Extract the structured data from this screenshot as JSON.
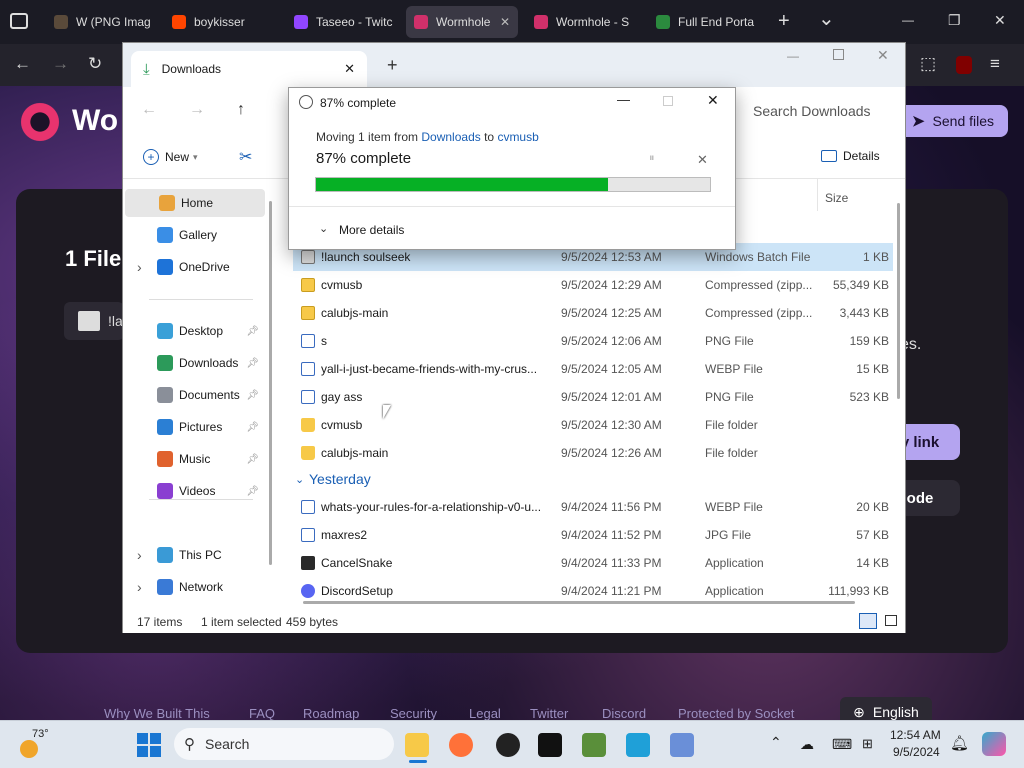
{
  "browser": {
    "tabs": [
      {
        "label": "W (PNG Imag",
        "color": "#5a4a3a"
      },
      {
        "label": "boykisser",
        "color": "#ff4500"
      },
      {
        "label": "Taseeo - Twitc",
        "color": "#9146ff"
      },
      {
        "label": "Wormhole",
        "color": "#d0306a"
      },
      {
        "label": "Wormhole - S",
        "color": "#d0306a"
      },
      {
        "label": "Full End Porta",
        "color": "#2b8a3e"
      }
    ],
    "new_tab": "+",
    "tab_list": "⌄",
    "min": "—",
    "max": "❐",
    "close": "✕"
  },
  "site": {
    "logo_text": "Wo",
    "send_files": "Send files",
    "heading": "1 File",
    "file_chip": "!la",
    "side_text": "es.",
    "copy_link": "y link",
    "code_btn": "ode",
    "footer": [
      "Why We Built This",
      "FAQ",
      "Roadmap",
      "Security",
      "Legal",
      "Twitter",
      "Discord",
      "Protected by Socket"
    ],
    "language": "English"
  },
  "explorer": {
    "tab_title": "Downloads",
    "new_tab": "+",
    "search_placeholder": "Search Downloads",
    "new_label": "New",
    "details_label": "Details",
    "size_header": "Size",
    "sidebar": [
      {
        "label": "Home",
        "color": "#e8a33c",
        "selected": true
      },
      {
        "label": "Gallery",
        "color": "#3a8ee6"
      },
      {
        "label": "OneDrive",
        "color": "#1e73d8",
        "expand": true
      },
      {
        "label": "Desktop",
        "color": "#3aa0d8",
        "pin": true
      },
      {
        "label": "Downloads",
        "color": "#2c9a5a",
        "pin": true
      },
      {
        "label": "Documents",
        "color": "#8a8f99",
        "pin": true
      },
      {
        "label": "Pictures",
        "color": "#2b7fd4",
        "pin": true
      },
      {
        "label": "Music",
        "color": "#e0622e",
        "pin": true
      },
      {
        "label": "Videos",
        "color": "#8a3fd1",
        "pin": true
      },
      {
        "label": "This PC",
        "color": "#3a9ad6",
        "expand": true
      },
      {
        "label": "Network",
        "color": "#3a7ad6",
        "expand": true
      }
    ],
    "files_today": [
      {
        "name": "!launch soulseek",
        "date": "9/5/2024 12:53 AM",
        "type": "Windows Batch File",
        "size": "1 KB",
        "icon": "bat",
        "selected": true
      },
      {
        "name": "cvmusb",
        "date": "9/5/2024 12:29 AM",
        "type": "Compressed (zipp...",
        "size": "55,349 KB",
        "icon": "zip"
      },
      {
        "name": "calubjs-main",
        "date": "9/5/2024 12:25 AM",
        "type": "Compressed (zipp...",
        "size": "3,443 KB",
        "icon": "zip"
      },
      {
        "name": "s",
        "date": "9/5/2024 12:06 AM",
        "type": "PNG File",
        "size": "159 KB",
        "icon": "doc"
      },
      {
        "name": "yall-i-just-became-friends-with-my-crus...",
        "date": "9/5/2024 12:05 AM",
        "type": "WEBP File",
        "size": "15 KB",
        "icon": "doc"
      },
      {
        "name": "gay ass",
        "date": "9/5/2024 12:01 AM",
        "type": "PNG File",
        "size": "523 KB",
        "icon": "doc"
      },
      {
        "name": "cvmusb",
        "date": "9/5/2024 12:30 AM",
        "type": "File folder",
        "size": "",
        "icon": "folder"
      },
      {
        "name": "calubjs-main",
        "date": "9/5/2024 12:26 AM",
        "type": "File folder",
        "size": "",
        "icon": "folder"
      }
    ],
    "group_yesterday": "Yesterday",
    "files_yesterday": [
      {
        "name": "whats-your-rules-for-a-relationship-v0-u...",
        "date": "9/4/2024 11:56 PM",
        "type": "WEBP File",
        "size": "20 KB",
        "icon": "doc"
      },
      {
        "name": "maxres2",
        "date": "9/4/2024 11:52 PM",
        "type": "JPG File",
        "size": "57 KB",
        "icon": "doc"
      },
      {
        "name": "CancelSnake",
        "date": "9/4/2024 11:33 PM",
        "type": "Application",
        "size": "14 KB",
        "icon": "app"
      },
      {
        "name": "DiscordSetup",
        "date": "9/4/2024 11:21 PM",
        "type": "Application",
        "size": "111,993 KB",
        "icon": "disc"
      }
    ],
    "status": {
      "items": "17 items",
      "selected": "1 item selected",
      "bytes": "459 bytes"
    }
  },
  "dialog": {
    "title": "87% complete",
    "moving_prefix": "Moving 1 item from ",
    "source": "Downloads",
    "to": " to ",
    "dest": "cvmusb",
    "percent_text": "87% complete",
    "progress": 0.74,
    "more_details": "More details",
    "pause": "⏸",
    "cancel": "✕"
  },
  "taskbar": {
    "weather_temp": "73°",
    "search": "Search",
    "time": "12:54 AM",
    "date": "9/5/2024"
  }
}
